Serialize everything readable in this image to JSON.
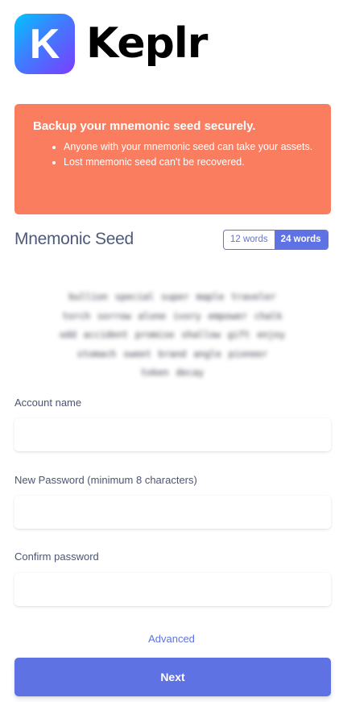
{
  "header": {
    "logo_letter": "K",
    "brand_name": "Keplr"
  },
  "warning": {
    "title": "Backup your mnemonic seed securely.",
    "items": [
      "Anyone with your mnemonic seed can take your assets.",
      "Lost mnemonic seed can't be recovered."
    ]
  },
  "mnemonic": {
    "title": "Mnemonic Seed",
    "options": [
      "12 words",
      "24 words"
    ],
    "selected": "24 words",
    "seed_lines": [
      "bullion special super maple traveler",
      "torch sorrow alone ivory empower chalk",
      "odd accident promise shallow gift enjoy",
      "stomach sweet brand angle pioneer",
      "token decay"
    ]
  },
  "form": {
    "account_name_label": "Account name",
    "account_name_value": "",
    "new_password_label": "New Password (minimum 8 characters)",
    "new_password_value": "",
    "confirm_password_label": "Confirm password",
    "confirm_password_value": ""
  },
  "advanced_label": "Advanced",
  "next_label": "Next",
  "colors": {
    "primary": "#5e72e4",
    "warning": "#fb7d60",
    "text": "#32325d"
  }
}
